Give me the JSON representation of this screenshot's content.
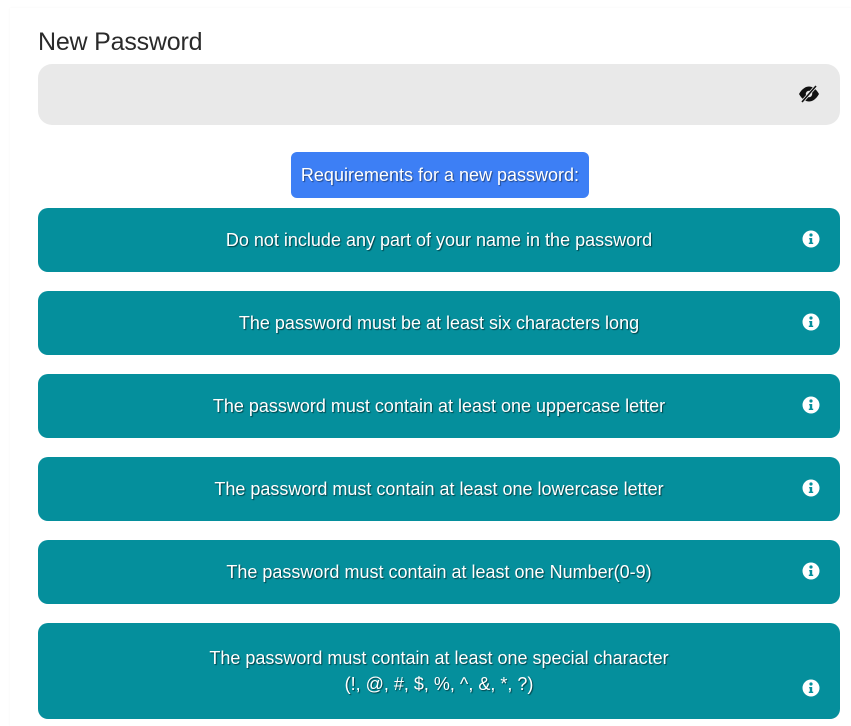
{
  "form": {
    "new_password_label": "New Password",
    "new_password_value": "",
    "toggle_visibility_icon": "eye-slash-icon"
  },
  "requirements": {
    "heading": "Requirements for a new password:",
    "info_icon": "info-circle-icon",
    "items": [
      {
        "text": "Do not include any part of your name in the password"
      },
      {
        "text": "The password must be at least six characters long"
      },
      {
        "text": "The password must contain at least one uppercase letter"
      },
      {
        "text": "The password must contain at least one lowercase letter"
      },
      {
        "text": "The password must contain at least one Number(0-9)"
      },
      {
        "text": "The password must contain at least one special character",
        "text_line2": "(!, @, #, $, %, ^, &, *, ?)"
      }
    ]
  },
  "colors": {
    "requirement_bg": "#058f9c",
    "heading_bg": "#3d7ff5",
    "field_bg": "#e9e9e9"
  }
}
